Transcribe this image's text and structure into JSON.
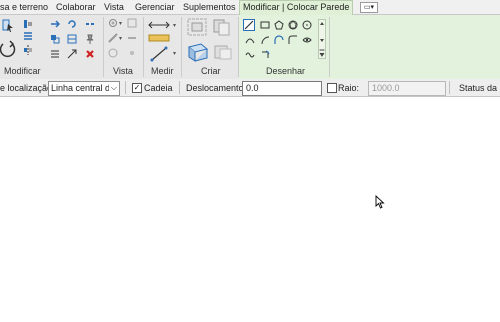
{
  "tabs": [
    {
      "label": "sa e terreno",
      "active": false
    },
    {
      "label": "Colaborar",
      "active": false
    },
    {
      "label": "Vista",
      "active": false
    },
    {
      "label": "Gerenciar",
      "active": false
    },
    {
      "label": "Suplementos",
      "active": false
    },
    {
      "label": "Modificar | Colocar Parede",
      "active": true
    }
  ],
  "ribbon_groups": {
    "modificar": "Modificar",
    "vista": "Vista",
    "medir": "Medir",
    "criar": "Criar",
    "desenhar": "Desenhar"
  },
  "options_bar": {
    "location_line_label": "e localização:",
    "location_line_value": "Linha central da",
    "chain_label": "Cadeia",
    "chain_checked": true,
    "offset_label": "Deslocamento:",
    "offset_value": "0.0",
    "radius_label": "Raio:",
    "radius_checked": false,
    "radius_value": "1000.0",
    "status_label": "Status da u"
  },
  "colors": {
    "contextual_tab": "#e3f2dc",
    "ribbon": "#e7e7e7",
    "accent_blue": "#2a6fb8",
    "accent_red": "#d02020"
  }
}
